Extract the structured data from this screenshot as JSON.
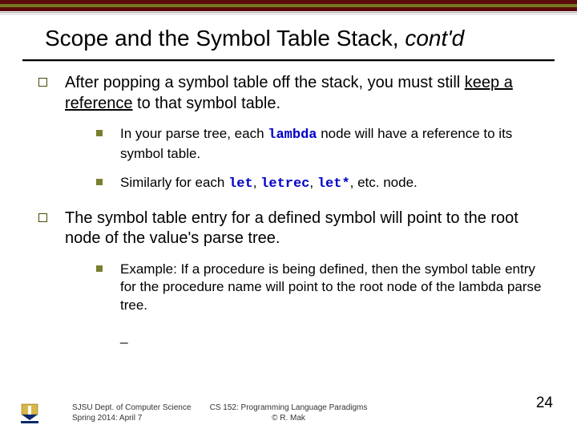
{
  "title_plain": "Scope and the Symbol Table Stack, ",
  "title_ital": "cont'd",
  "bullets": [
    {
      "pre": "After popping a symbol table off the stack, you must still ",
      "under": "keep a reference",
      "post": " to that symbol table.",
      "subs": [
        {
          "parts": [
            {
              "t": "In your parse tree, each "
            },
            {
              "t": "lambda",
              "code": true
            },
            {
              "t": " node will have a reference to its symbol table."
            }
          ]
        },
        {
          "parts": [
            {
              "t": "Similarly for each "
            },
            {
              "t": "let",
              "code": true
            },
            {
              "t": ", "
            },
            {
              "t": "letrec",
              "code": true
            },
            {
              "t": ", "
            },
            {
              "t": "let*",
              "code": true
            },
            {
              "t": ", etc. node."
            }
          ]
        }
      ]
    },
    {
      "pre": "The symbol table entry for a defined symbol will point to the root node of the value's parse tree.",
      "under": "",
      "post": "",
      "subs": [
        {
          "parts": [
            {
              "t": "Example: If a procedure is being defined, then the symbol table entry for the procedure name will point to the root node of the lambda parse tree."
            }
          ]
        }
      ],
      "trailing_dash": "_"
    }
  ],
  "footer": {
    "left_line1": "SJSU Dept. of Computer Science",
    "left_line2": "Spring 2014: April 7",
    "center_line1": "CS 152: Programming Language Paradigms",
    "center_line2": "© R. Mak",
    "page": "24"
  }
}
